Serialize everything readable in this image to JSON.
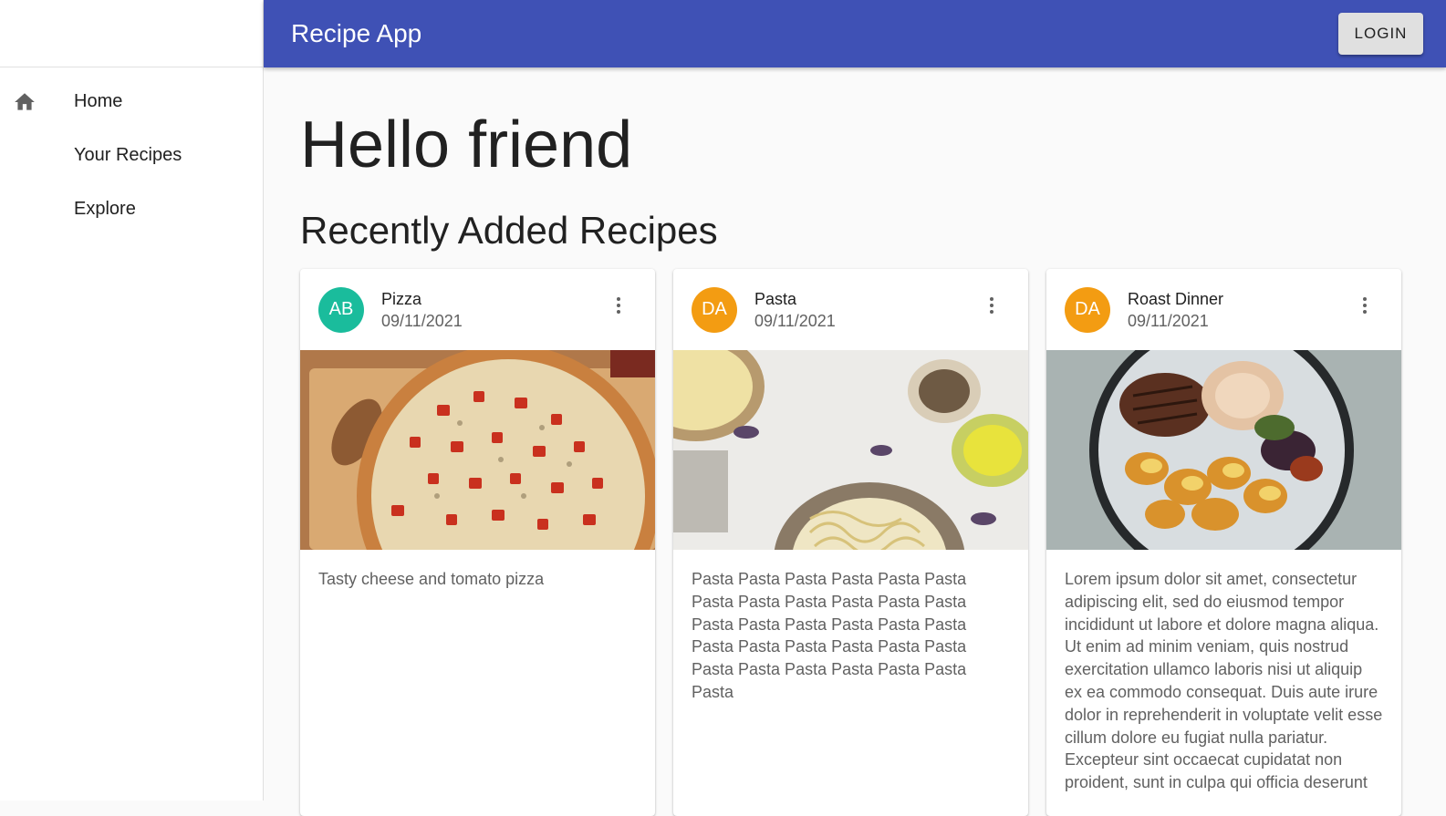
{
  "app": {
    "title": "Recipe App",
    "login_label": "LOGIN"
  },
  "colors": {
    "appbar": "#3f51b5",
    "avatar_teal": "#1abc9c",
    "avatar_orange": "#f39c12"
  },
  "sidebar": {
    "items": [
      {
        "label": "Home",
        "icon": "home-icon"
      },
      {
        "label": "Your Recipes"
      },
      {
        "label": "Explore"
      }
    ]
  },
  "main": {
    "greeting": "Hello friend",
    "section_title": "Recently Added Recipes",
    "cards": [
      {
        "avatar": "AB",
        "avatar_color": "#1abc9c",
        "title": "Pizza",
        "date": "09/11/2021",
        "image": "pizza-image",
        "description": "Tasty cheese and tomato pizza"
      },
      {
        "avatar": "DA",
        "avatar_color": "#f39c12",
        "title": "Pasta",
        "date": "09/11/2021",
        "image": "pasta-image",
        "description": "Pasta Pasta Pasta Pasta Pasta Pasta Pasta Pasta Pasta Pasta Pasta Pasta Pasta Pasta Pasta Pasta Pasta Pasta Pasta Pasta Pasta Pasta Pasta Pasta Pasta Pasta Pasta Pasta Pasta Pasta Pasta"
      },
      {
        "avatar": "DA",
        "avatar_color": "#f39c12",
        "title": "Roast Dinner",
        "date": "09/11/2021",
        "image": "roast-dinner-image",
        "description": "Lorem ipsum dolor sit amet, consectetur adipiscing elit, sed do eiusmod tempor incididunt ut labore et dolore magna aliqua. Ut enim ad minim veniam, quis nostrud exercitation ullamco laboris nisi ut aliquip ex ea commodo consequat. Duis aute irure dolor in reprehenderit in voluptate velit esse cillum dolore eu fugiat nulla pariatur. Excepteur sint occaecat cupidatat non proident, sunt in culpa qui officia deserunt"
      }
    ]
  }
}
